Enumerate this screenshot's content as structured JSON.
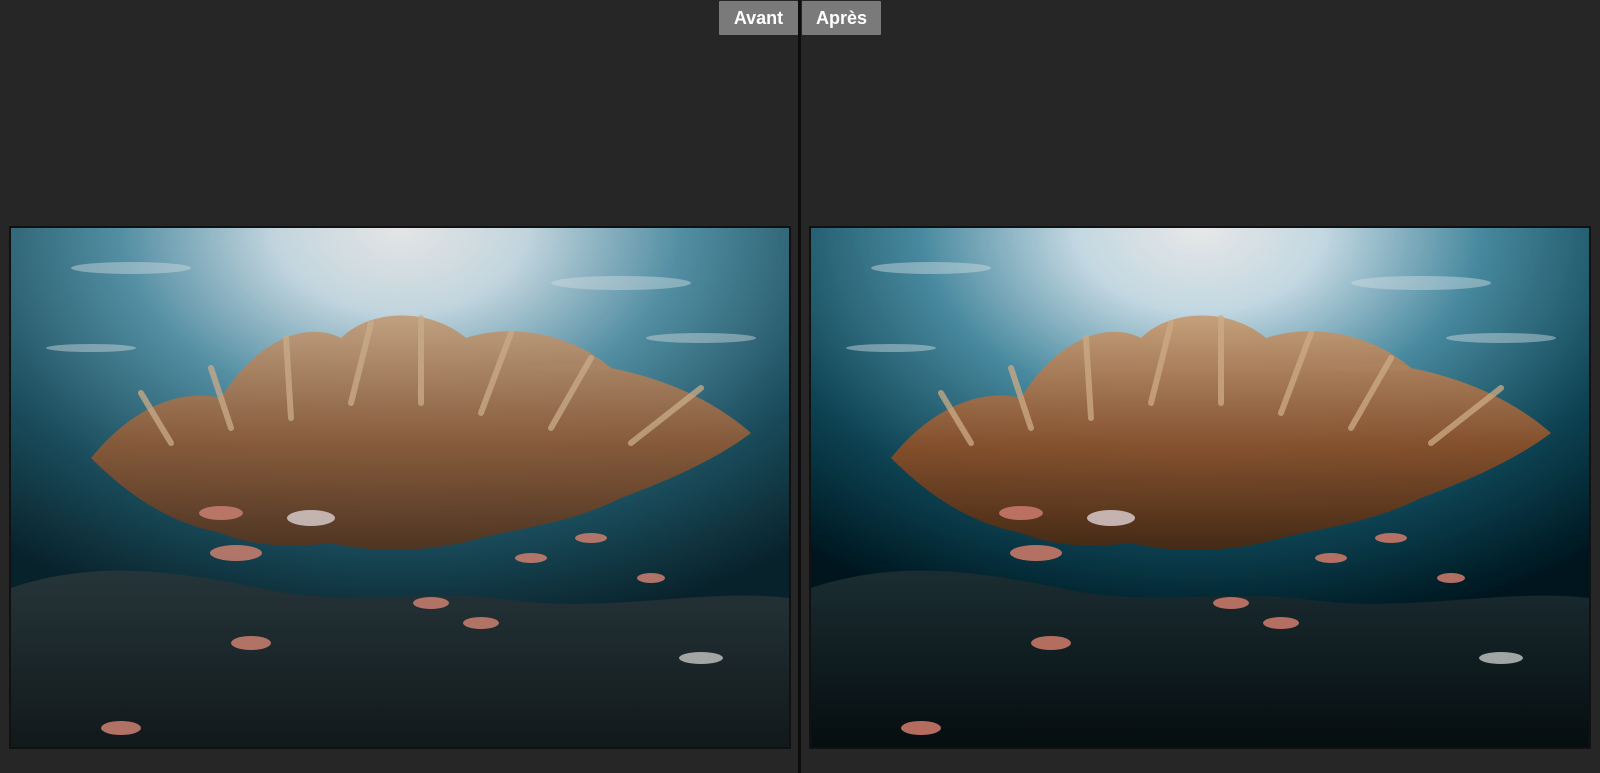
{
  "compare": {
    "before_label": "Avant",
    "after_label": "Après"
  },
  "colors": {
    "background": "#262626",
    "label_bg": "#7a7a7a",
    "divider": "#0d0d0d",
    "water_top": "#cfe8f5",
    "water_mid": "#2d6f84",
    "water_deep": "#0b2a33",
    "coral": "#a06a45",
    "fish": "#d98a7a"
  }
}
